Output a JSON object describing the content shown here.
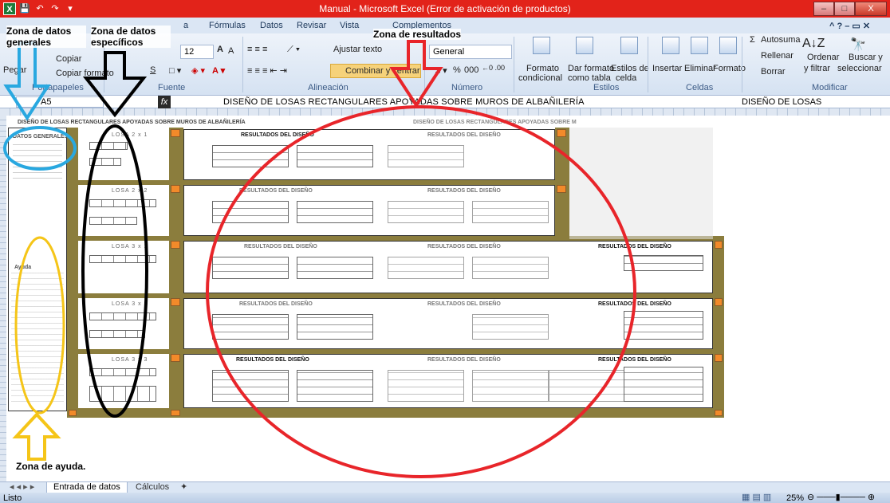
{
  "window": {
    "title": "Manual  -  Microsoft Excel (Error de activación de productos)",
    "minimize": "–",
    "maximize": "□",
    "close": "X"
  },
  "qat": [
    "X",
    "💾",
    "↶",
    "↷",
    "▾"
  ],
  "ribbon": {
    "tabs": [
      "a",
      "Fórmulas",
      "Datos",
      "Revisar",
      "Vista",
      "Complementos"
    ],
    "clipboard": {
      "copy": "Copiar",
      "paste": "Pegar",
      "format_painter": "Copiar formato",
      "group": "Portapapeles"
    },
    "font": {
      "size": "12",
      "grow": "A",
      "shrink": "A",
      "group": "Fuente",
      "underline": "S"
    },
    "alignment": {
      "wrap": "Ajustar texto",
      "merge": "Combinar y centrar",
      "group": "Alineación"
    },
    "number": {
      "format": "General",
      "percent": "%",
      "thousands": "000",
      "group": "Número"
    },
    "styles": {
      "cond_format_1": "Formato",
      "cond_format_2": "condicional",
      "table_format_1": "Dar formato",
      "table_format_2": "como tabla",
      "cell_styles_1": "Estilos de",
      "cell_styles_2": "celda",
      "group": "Estilos"
    },
    "cells": {
      "insert": "Insertar",
      "delete": "Eliminar",
      "format": "Formato",
      "group": "Celdas"
    },
    "editing": {
      "autosum": "Autosuma",
      "fill": "Rellenar",
      "clear": "Borrar",
      "sort_1": "Ordenar",
      "sort_2": "y filtrar",
      "find_1": "Buscar y",
      "find_2": "seleccionar",
      "group": "Modificar"
    }
  },
  "formula_bar": {
    "namebox": "A5",
    "fx": "fx",
    "content": "DISEÑO DE LOSAS RECTANGULARES APOYADAS SOBRE MUROS DE ALBAÑILERÍA",
    "right": "DISEÑO DE LOSAS"
  },
  "sheet": {
    "title": "DISEÑO DE LOSAS RECTANGULARES APOYADAS SOBRE MUROS DE ALBAÑILERÍA",
    "title_right": "DISEÑO DE LOSAS RECTANGULARES APOYADAS SOBRE M",
    "general_data_header": "DATOS GENERALES",
    "help_header": "Ayuda",
    "slabs": [
      "LOSA 2 x 1",
      "LOSA 2 x 2",
      "LOSA 3 x 1",
      "LOSA 3 x 2",
      "LOSA 3 x 3"
    ],
    "results_header": "RESULTADOS DEL DISEÑO"
  },
  "annotations": {
    "general": "Zona de datos generales",
    "specific": "Zona de datos específicos",
    "results": "Zona de resultados",
    "help": "Zona de ayuda."
  },
  "sheet_tabs": [
    "Entrada de datos",
    "Cálculos"
  ],
  "status": {
    "left": "Listo",
    "zoom": "25%"
  },
  "colors": {
    "title_bar": "#e2231a",
    "annot_blue": "#29a8e0",
    "annot_black": "#000000",
    "annot_red": "#e8252a",
    "annot_yellow": "#f5c518",
    "olive": "#8b7d3d",
    "orange": "#f28a2a"
  }
}
